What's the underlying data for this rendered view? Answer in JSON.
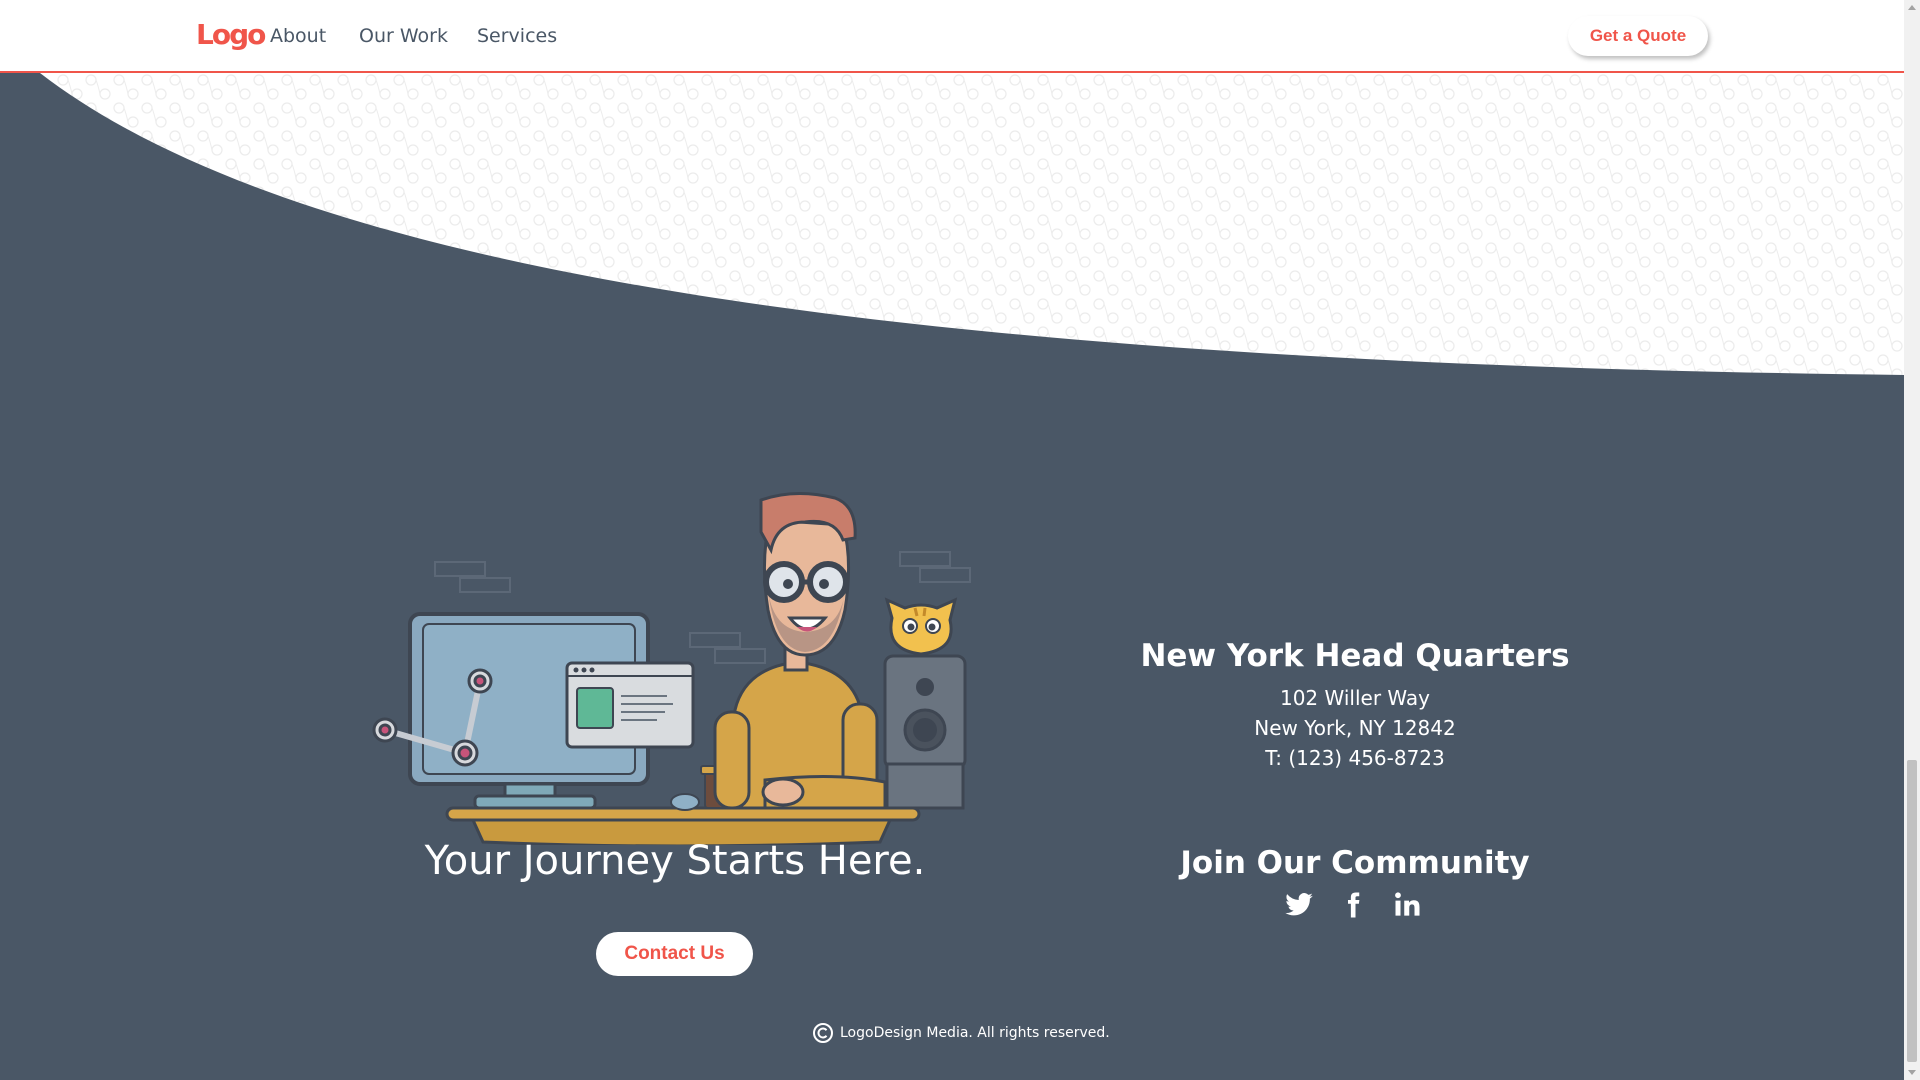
{
  "nav": {
    "logo": "Logo",
    "links": [
      "About",
      "Our Work",
      "Services"
    ],
    "cta": "Get a Quote"
  },
  "hero": {
    "tagline": "Your Journey Starts Here.",
    "contact_button": "Contact Us"
  },
  "headquarters": {
    "title": "New York Head Quarters",
    "street": "102 Willer Way",
    "city": "New York, NY 12842",
    "phone": "T: (123) 456-8723"
  },
  "community": {
    "title": "Join Our Community",
    "icons": [
      "twitter-icon",
      "facebook-icon",
      "linkedin-icon"
    ]
  },
  "footer": {
    "copyright": "LogoDesign Media. All rights reserved."
  },
  "colors": {
    "accent": "#f0554a",
    "dark_background": "#4a5766",
    "light_background": "#ffffff"
  }
}
